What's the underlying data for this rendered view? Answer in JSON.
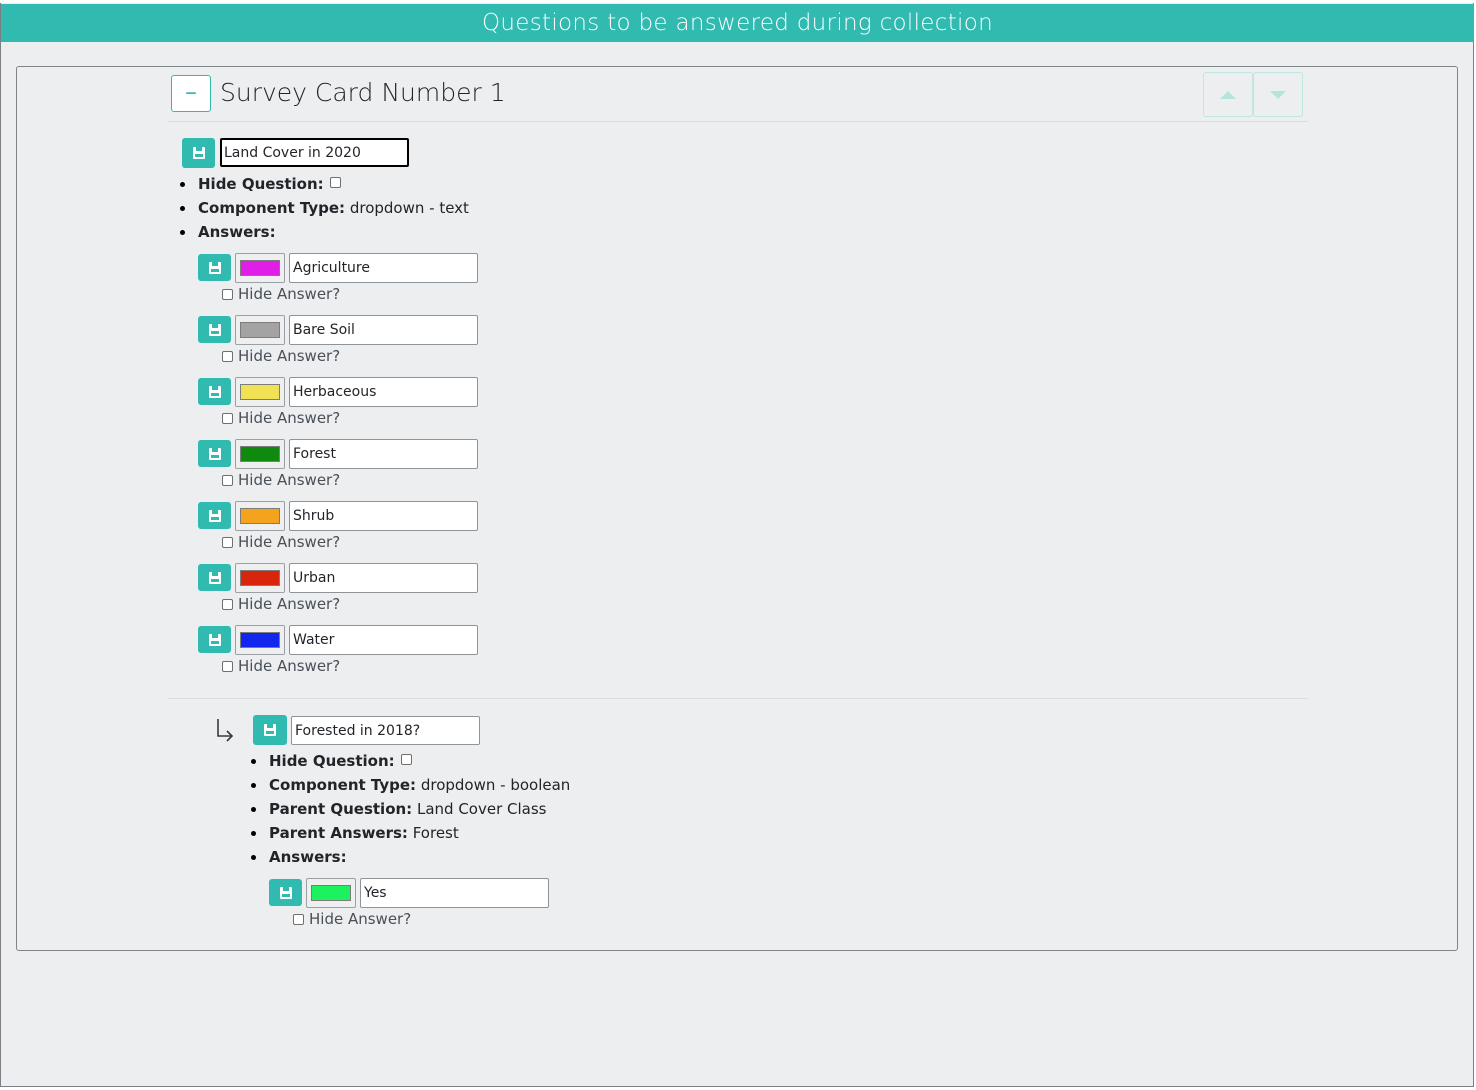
{
  "header": {
    "title": "Questions to be answered during collection"
  },
  "card": {
    "title": "Survey Card Number 1",
    "collapse_symbol": "–",
    "move_up_icon": "caret-up-icon",
    "move_down_icon": "caret-down-icon"
  },
  "labels": {
    "hide_question": "Hide Question:",
    "component_type": "Component Type:",
    "answers": "Answers:",
    "parent_question": "Parent Question:",
    "parent_answers": "Parent Answers:",
    "hide_answer": "Hide Answer?"
  },
  "question1": {
    "text": "Land Cover in 2020",
    "hidden": false,
    "component_type": "dropdown - text",
    "answers": [
      {
        "label": "Agriculture",
        "color": "#e11ee8",
        "hidden": false
      },
      {
        "label": "Bare Soil",
        "color": "#a3a3a3",
        "hidden": false
      },
      {
        "label": "Herbaceous",
        "color": "#f0e155",
        "hidden": false
      },
      {
        "label": "Forest",
        "color": "#0f8a0f",
        "hidden": false
      },
      {
        "label": "Shrub",
        "color": "#f4a31c",
        "hidden": false
      },
      {
        "label": "Urban",
        "color": "#d8260c",
        "hidden": false
      },
      {
        "label": "Water",
        "color": "#1227ed",
        "hidden": false
      }
    ]
  },
  "question2": {
    "text": "Forested in 2018?",
    "hidden": false,
    "component_type": "dropdown - boolean",
    "parent_question": "Land Cover Class",
    "parent_answers": "Forest",
    "answers": [
      {
        "label": "Yes",
        "color": "#1cf25d",
        "hidden": false
      }
    ]
  },
  "colors": {
    "accent": "#31bab0",
    "background": "#eceef0"
  }
}
